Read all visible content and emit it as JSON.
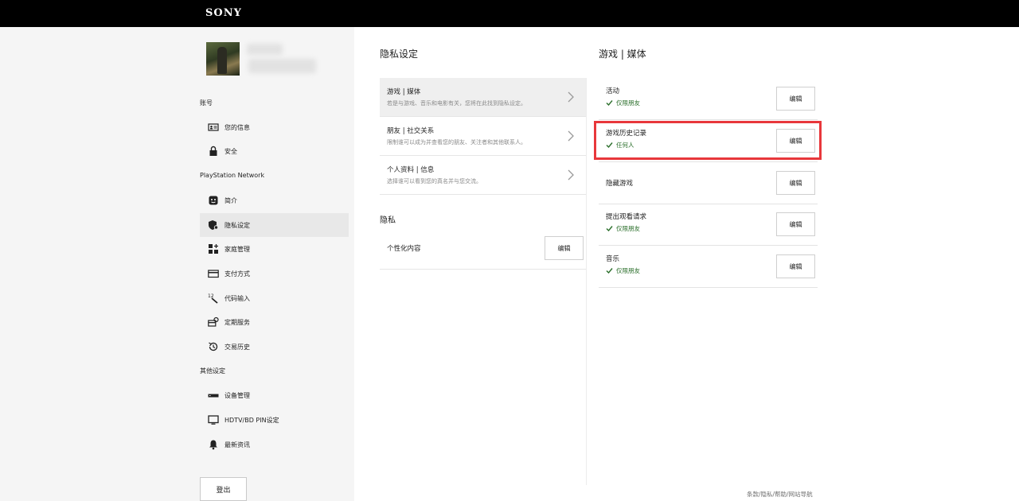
{
  "header": {
    "logo": "SONY"
  },
  "sidebar": {
    "sections": [
      {
        "label": "账号"
      },
      {
        "label": "PlayStation Network"
      },
      {
        "label": "其他设定"
      }
    ],
    "items": [
      {
        "label": "您的信息",
        "icon": "id-card-icon"
      },
      {
        "label": "安全",
        "icon": "lock-icon"
      },
      {
        "label": "简介",
        "icon": "profile-face-icon"
      },
      {
        "label": "隐私设定",
        "icon": "privacy-shield-icon",
        "selected": true
      },
      {
        "label": "家庭管理",
        "icon": "family-icon"
      },
      {
        "label": "支付方式",
        "icon": "credit-card-icon"
      },
      {
        "label": "代码输入",
        "icon": "code-entry-icon"
      },
      {
        "label": "定期服务",
        "icon": "subscription-icon"
      },
      {
        "label": "交易历史",
        "icon": "history-icon"
      },
      {
        "label": "设备管理",
        "icon": "console-icon"
      },
      {
        "label": "HDTV/BD PIN设定",
        "icon": "tv-icon"
      },
      {
        "label": "最新资讯",
        "icon": "bell-icon"
      }
    ],
    "logout_label": "登出"
  },
  "middle": {
    "title": "隐私设定",
    "items": [
      {
        "title": "游戏 | 媒体",
        "desc": "若是与游戏、音乐和电影有关，您将在此找到隐私设定。"
      },
      {
        "title": "朋友 | 社交关系",
        "desc": "限制谁可以成为并查看您的朋友、关注者和其他联系人。"
      },
      {
        "title": "个人资料 | 信息",
        "desc": "选择谁可以看到您的真名并与您交流。"
      }
    ],
    "privacy_heading": "隐私",
    "privacy_row": {
      "label": "个性化内容",
      "button": "编辑"
    }
  },
  "right": {
    "title": "游戏 | 媒体",
    "rows": [
      {
        "label": "活动",
        "status": "仅限朋友",
        "button": "编辑"
      },
      {
        "label": "游戏历史记录",
        "status": "任何人",
        "button": "编辑"
      },
      {
        "label": "隐藏游戏",
        "status": "",
        "button": "编辑"
      },
      {
        "label": "提出观看请求",
        "status": "仅限朋友",
        "button": "编辑"
      },
      {
        "label": "音乐",
        "status": "仅限朋友",
        "button": "编辑"
      }
    ]
  },
  "footer": {
    "links": "条款/隐私/帮助/网站导航"
  },
  "colors": {
    "topbar": "#000000",
    "sidebar_bg": "#f5f5f5",
    "status_green": "#2a6e2a",
    "highlight_red": "#e8373b"
  }
}
